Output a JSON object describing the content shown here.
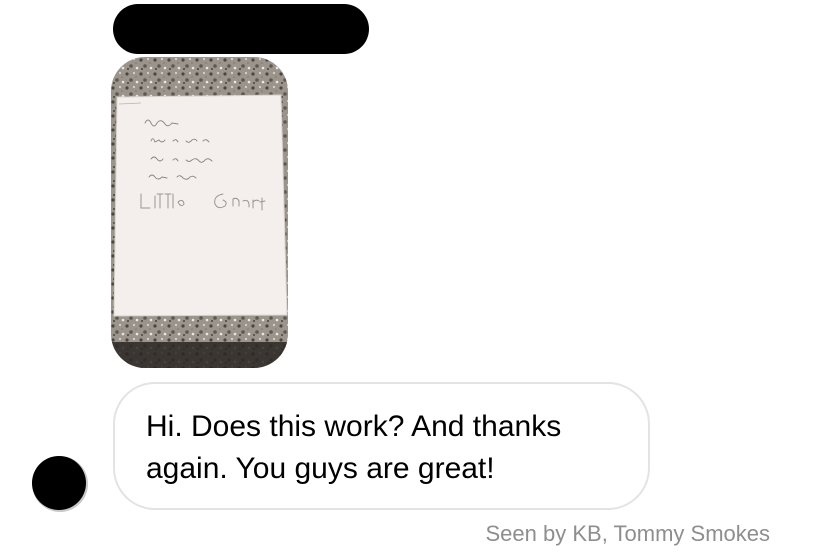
{
  "thread": {
    "photo_message": {
      "note": {
        "lines": [
          "Baseball Smoke,",
          "It is ok to post my",
          "video on your Instagram",
          "account. Thank You!"
        ],
        "signature": "Little Gnats"
      }
    },
    "text_message": "Hi.  Does this work?  And thanks\nagain.  You guys are great!",
    "seen_receipt": "Seen by KB, Tommy Smokes"
  }
}
